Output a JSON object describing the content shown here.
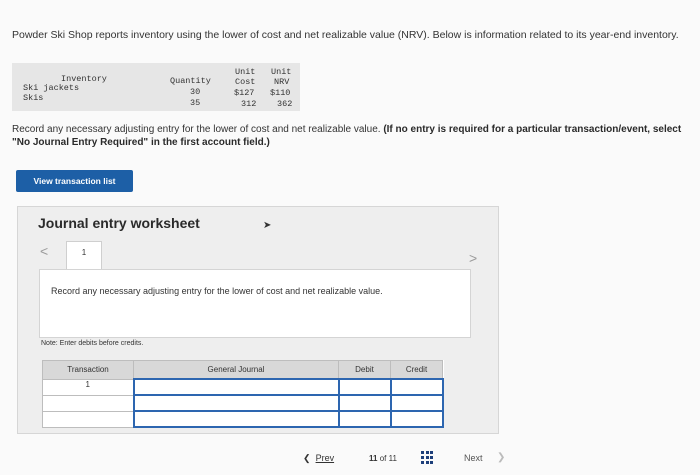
{
  "problem": {
    "intro": "Powder Ski Shop reports inventory using the lower of cost and net realizable value (NRV). Below is information related to its year-end inventory.",
    "table": {
      "headers": {
        "inventory": "Inventory",
        "quantity": "Quantity",
        "unit_cost_1": "Unit",
        "unit_cost_2": "Cost",
        "unit_nrv_1": "Unit",
        "unit_nrv_2": "NRV"
      },
      "rows": [
        {
          "item": "Ski jackets",
          "quantity": "30",
          "cost": "$127",
          "nrv": "$110"
        },
        {
          "item": "Skis",
          "quantity": "35",
          "cost": "312",
          "nrv": "362"
        }
      ]
    },
    "instruction_plain": "Record any necessary adjusting entry for the lower of cost and net realizable value.",
    "instruction_bold": "(If no entry is required for a particular transaction/event, select \"No Journal Entry Required\" in the first account field.)"
  },
  "buttons": {
    "view_transaction_list": "View transaction list"
  },
  "worksheet": {
    "title": "Journal entry worksheet",
    "tab_number": "1",
    "prev_arrow": "<",
    "next_arrow": ">",
    "instruction": "Record any necessary adjusting entry for the lower of cost and net realizable value.",
    "note": "Note: Enter debits before credits.",
    "columns": {
      "transaction": "Transaction",
      "general_journal": "General Journal",
      "debit": "Debit",
      "credit": "Credit"
    },
    "rows": [
      {
        "transaction": "1",
        "account": "",
        "debit": "",
        "credit": ""
      },
      {
        "transaction": "",
        "account": "",
        "debit": "",
        "credit": ""
      },
      {
        "transaction": "",
        "account": "",
        "debit": "",
        "credit": ""
      }
    ]
  },
  "pagination": {
    "prev_label": "Prev",
    "current": "11",
    "of_label": "of",
    "total": "11",
    "next_label": "Next"
  },
  "icons": {
    "prev": "chevron-left-icon",
    "next": "chevron-right-icon",
    "grid": "grid-icon",
    "cursor": "mouse-cursor-icon"
  },
  "colors": {
    "primary_button": "#1d5fa6",
    "field_border": "#2d66b0"
  }
}
